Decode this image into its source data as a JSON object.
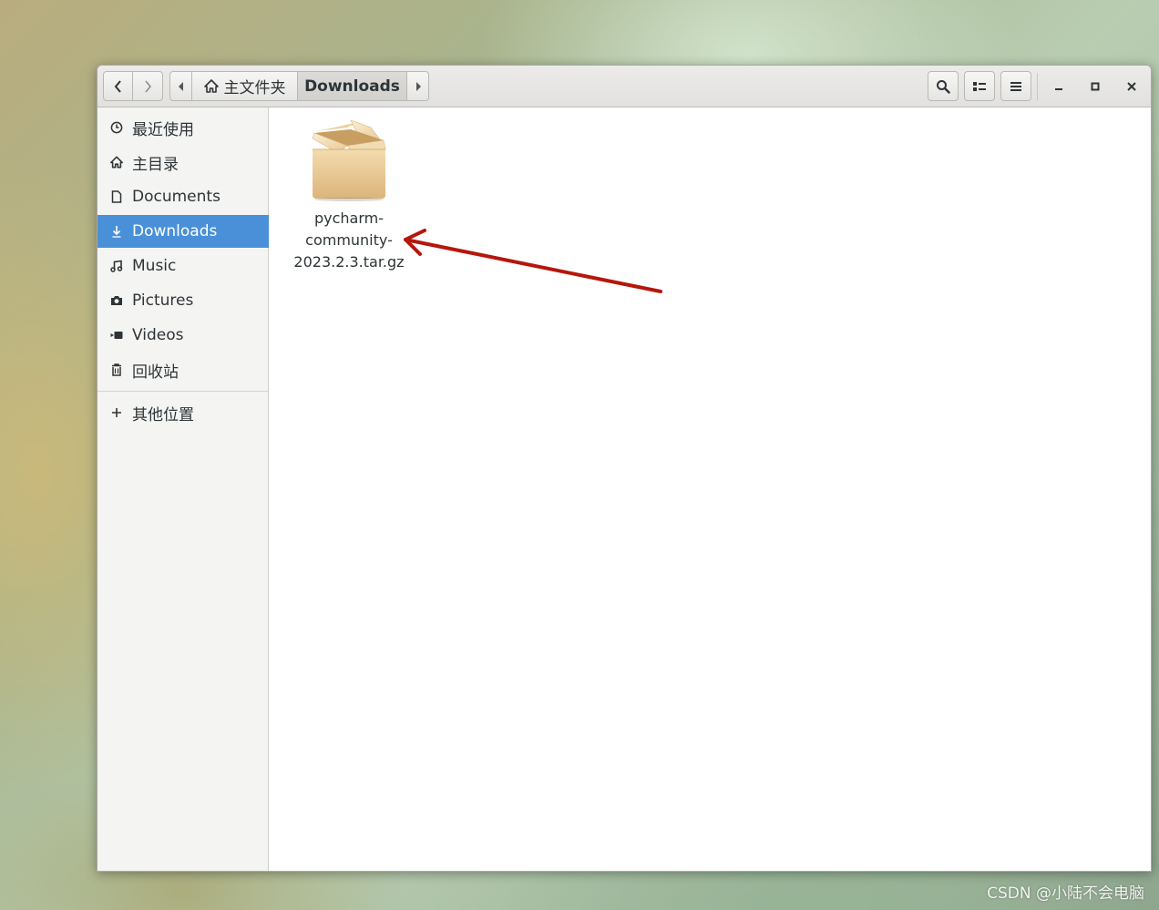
{
  "breadcrumb": {
    "home_label": "主文件夹",
    "current_label": "Downloads"
  },
  "sidebar": {
    "items": [
      {
        "label": "最近使用",
        "icon": "clock-icon"
      },
      {
        "label": "主目录",
        "icon": "home-icon"
      },
      {
        "label": "Documents",
        "icon": "document-icon"
      },
      {
        "label": "Downloads",
        "icon": "download-icon",
        "active": true
      },
      {
        "label": "Music",
        "icon": "music-icon"
      },
      {
        "label": "Pictures",
        "icon": "camera-icon"
      },
      {
        "label": "Videos",
        "icon": "video-icon"
      },
      {
        "label": "回收站",
        "icon": "trash-icon"
      }
    ],
    "other_locations": {
      "label": "其他位置",
      "icon": "plus-icon"
    }
  },
  "files": [
    {
      "name": "pycharm-\ncommunity-\n2023.2.3.tar.gz",
      "icon": "archive-icon"
    }
  ],
  "watermark": "CSDN @小陆不会电脑",
  "colors": {
    "accent": "#4a90d9",
    "annotation_arrow": "#b5170c",
    "sidebar_bg": "#f4f4f3",
    "headerbar_bg": "#e8e8e7"
  }
}
